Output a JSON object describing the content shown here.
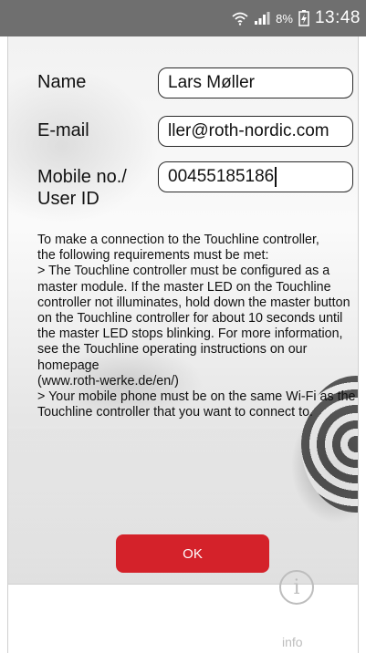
{
  "status_bar": {
    "battery_percent": "8%",
    "time": "13:48"
  },
  "form": {
    "name_label": "Name",
    "name_value": "Lars Møller",
    "email_label": "E-mail",
    "email_value": "ller@roth-nordic.com",
    "mobile_label_line1": "Mobile no./",
    "mobile_label_line2": "User ID",
    "mobile_value": "00455185186"
  },
  "instructions": "To make a connection to the Touchline controller,\nthe following requirements must be met:\n> The Touchline controller must be configured as a master module. If the master LED on the Touchline controller not illuminates, hold down the master button on the Touchline controller for about 10 seconds until the master LED stops blinking. For more information, see the Touchline operating instructions on our homepage\n (www.roth-werke.de/en/)\n > Your mobile phone must be on the same Wi-Fi as the Touchline controller that you want to connect to.",
  "ok_label": "OK",
  "bottom": {
    "info_label": "info"
  },
  "icons": {
    "wifi": "wifi-icon",
    "signal": "signal-icon",
    "battery": "battery-charging-icon",
    "info": "info-icon"
  },
  "colors": {
    "accent": "#d4222a",
    "status_bar": "#6f6f6f"
  }
}
